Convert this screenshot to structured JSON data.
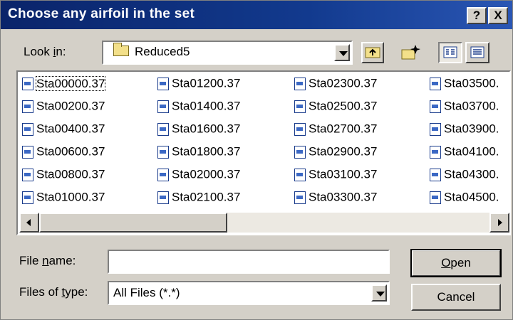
{
  "window": {
    "title": "Choose any airfoil in the set",
    "help_glyph": "?",
    "close_glyph": "X"
  },
  "look_in": {
    "label_prefix": "Look ",
    "label_accel": "i",
    "label_suffix": "n:",
    "folder": "Reduced5",
    "folder_icon": "folder-icon"
  },
  "toolbar": {
    "icons": [
      "up-one-level-icon",
      "create-new-folder-icon",
      "list-view-icon",
      "details-view-icon"
    ]
  },
  "files": {
    "columns": [
      [
        "Sta00000.37",
        "Sta00200.37",
        "Sta00400.37",
        "Sta00600.37",
        "Sta00800.37",
        "Sta01000.37"
      ],
      [
        "Sta01200.37",
        "Sta01400.37",
        "Sta01600.37",
        "Sta01800.37",
        "Sta02000.37",
        "Sta02100.37"
      ],
      [
        "Sta02300.37",
        "Sta02500.37",
        "Sta02700.37",
        "Sta02900.37",
        "Sta03100.37",
        "Sta03300.37"
      ],
      [
        "Sta03500.",
        "Sta03700.",
        "Sta03900.",
        "Sta04100.",
        "Sta04300.",
        "Sta04500."
      ]
    ],
    "selected": "Sta00000.37",
    "file_icon": "file-icon"
  },
  "scrollbar": {
    "position": 0.0,
    "left_icon": "scroll-left-icon",
    "right_icon": "scroll-right-icon"
  },
  "filename": {
    "label_prefix": "File ",
    "label_accel": "n",
    "label_suffix": "ame:",
    "value": ""
  },
  "filetype": {
    "label_prefix": "Files of ",
    "label_accel": "t",
    "label_suffix": "ype:",
    "value": "All Files (*.*)"
  },
  "buttons": {
    "open_accel": "O",
    "open_rest": "pen",
    "cancel": "Cancel"
  }
}
